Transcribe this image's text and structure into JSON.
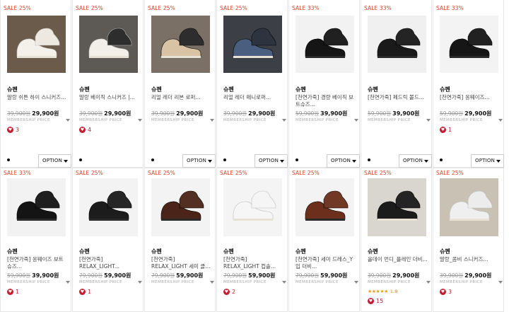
{
  "colors": {
    "sale": "#d8442b",
    "heart": "#c21e2f",
    "star": "#e6a21b"
  },
  "member_label": "MEMBERSHIP PRICE",
  "option_label": "OPTION",
  "row1": [
    {
      "sale": "SALE 25%",
      "brand": "슈펜",
      "name": "말랑 쉬튼 하이 스니커즈...",
      "old": "39,900원",
      "price": "29,900원",
      "likes": "3",
      "option": true,
      "img": "white-sneakers"
    },
    {
      "sale": "SALE 25%",
      "brand": "슈펜",
      "name": "말랑 베이직 스니커즈 |...",
      "old": "39,900원",
      "price": "29,900원",
      "likes": "4",
      "option": false,
      "img": "white-sneaker-single"
    },
    {
      "sale": "SALE 25%",
      "brand": "슈펜",
      "name": "리얼 레더 리본 로퍼...",
      "old": "39,900원",
      "price": "29,900원",
      "likes": "",
      "option": true,
      "img": "loafers-row"
    },
    {
      "sale": "SALE 25%",
      "brand": "슈펜",
      "name": "리얼 레더 페니로퍼...",
      "old": "39,900원",
      "price": "29,900원",
      "likes": "",
      "option": true,
      "img": "penny-loafers"
    },
    {
      "sale": "SALE 33%",
      "brand": "슈펜",
      "name": "[천연가죽] 경량 베이직 보트슈즈...",
      "old": "59,900원",
      "price": "39,900원",
      "likes": "",
      "option": true,
      "img": "black-derby"
    },
    {
      "sale": "SALE 33%",
      "brand": "슈펜",
      "name": "[천연가죽] 페드릭 볼드...",
      "old": "59,900원",
      "price": "39,900원",
      "likes": "",
      "option": true,
      "img": "black-loafer"
    },
    {
      "sale": "SALE 33%",
      "brand": "슈펜",
      "name": "[천연가죽] 옹웨이즈...",
      "old": "59,900원",
      "price": "29,900원",
      "likes": "1",
      "option": true,
      "img": "black-slipon"
    }
  ],
  "row2": [
    {
      "sale": "SALE 33%",
      "brand": "슈펜",
      "name": "[천연가죽] 옹웨이즈 보트슈즈...",
      "old": "59,900원",
      "price": "39,900원",
      "likes": "1",
      "stars": "",
      "img": "black-derby-2"
    },
    {
      "sale": "SALE 25%",
      "brand": "슈펜",
      "name": "[천연가죽] RELAX_LIGHT...",
      "old": "79,900원",
      "price": "59,900원",
      "likes": "1",
      "stars": "",
      "img": "black-sneaker"
    },
    {
      "sale": "SALE 25%",
      "brand": "슈펜",
      "name": "[천연가죽] RELAX_LIGHT 세미 클...",
      "old": "79,900원",
      "price": "59,900원",
      "likes": "",
      "stars": "",
      "img": "brown-oxford"
    },
    {
      "sale": "SALE 25%",
      "brand": "슈펜",
      "name": "[천연가죽] RELAX_LIGHT 컵솔...",
      "old": "79,900원",
      "price": "59,900원",
      "likes": "2",
      "stars": "",
      "img": "white-cupsole"
    },
    {
      "sale": "SALE 25%",
      "brand": "슈펜",
      "name": "[천연가죽] 세미 드레스_Y입 더비...",
      "old": "79,900원",
      "price": "59,900원",
      "likes": "",
      "stars": "",
      "img": "brown-derby"
    },
    {
      "sale": "SALE 25%",
      "brand": "슈펜",
      "name": "올데이 먼디_플레인 더비...",
      "old": "39,900원",
      "price": "29,900원",
      "likes": "15",
      "stars": "1.8",
      "img": "model-derby"
    },
    {
      "sale": "SALE 25%",
      "brand": "슈펜",
      "name": "말랑_콤비 스니커즈...",
      "old": "39,900원",
      "price": "29,900원",
      "likes": "3",
      "stars": "",
      "img": "combi-sneakers"
    }
  ]
}
